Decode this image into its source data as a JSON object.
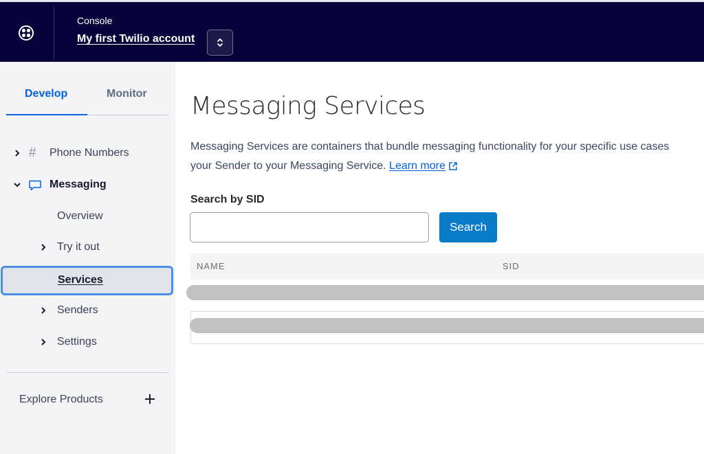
{
  "header": {
    "console_label": "Console",
    "account_name": "My first Twilio account",
    "logo_icon": "twilio-logo-icon",
    "switcher_icon": "chevron-up-down-icon"
  },
  "sidebar": {
    "tabs": [
      {
        "label": "Develop",
        "active": true
      },
      {
        "label": "Monitor",
        "active": false
      }
    ],
    "items": [
      {
        "label": "Phone Numbers",
        "icon": "hash-icon",
        "expanded": false
      },
      {
        "label": "Messaging",
        "icon": "chat-bubble-icon",
        "expanded": true
      },
      {
        "label": "Overview"
      },
      {
        "label": "Try it out",
        "expandable": true
      },
      {
        "label": "Services",
        "selected": true
      },
      {
        "label": "Senders",
        "expandable": true
      },
      {
        "label": "Settings",
        "expandable": true
      }
    ],
    "explore_label": "Explore Products"
  },
  "main": {
    "title": "Messaging Services",
    "description_line1": "Messaging Services are containers that bundle messaging functionality for your specific use cases",
    "description_line2": "your Sender to your Messaging Service.",
    "learn_more": "Learn more",
    "search_label": "Search by SID",
    "search_value": "",
    "search_placeholder": "",
    "search_button": "Search",
    "table": {
      "columns": [
        "NAME",
        "SID"
      ],
      "rows_loading": 2
    }
  },
  "colors": {
    "header_bg": "#06033a",
    "accent": "#0263e0",
    "button": "#0a7bc8",
    "focus_ring": "#4a90e2"
  }
}
